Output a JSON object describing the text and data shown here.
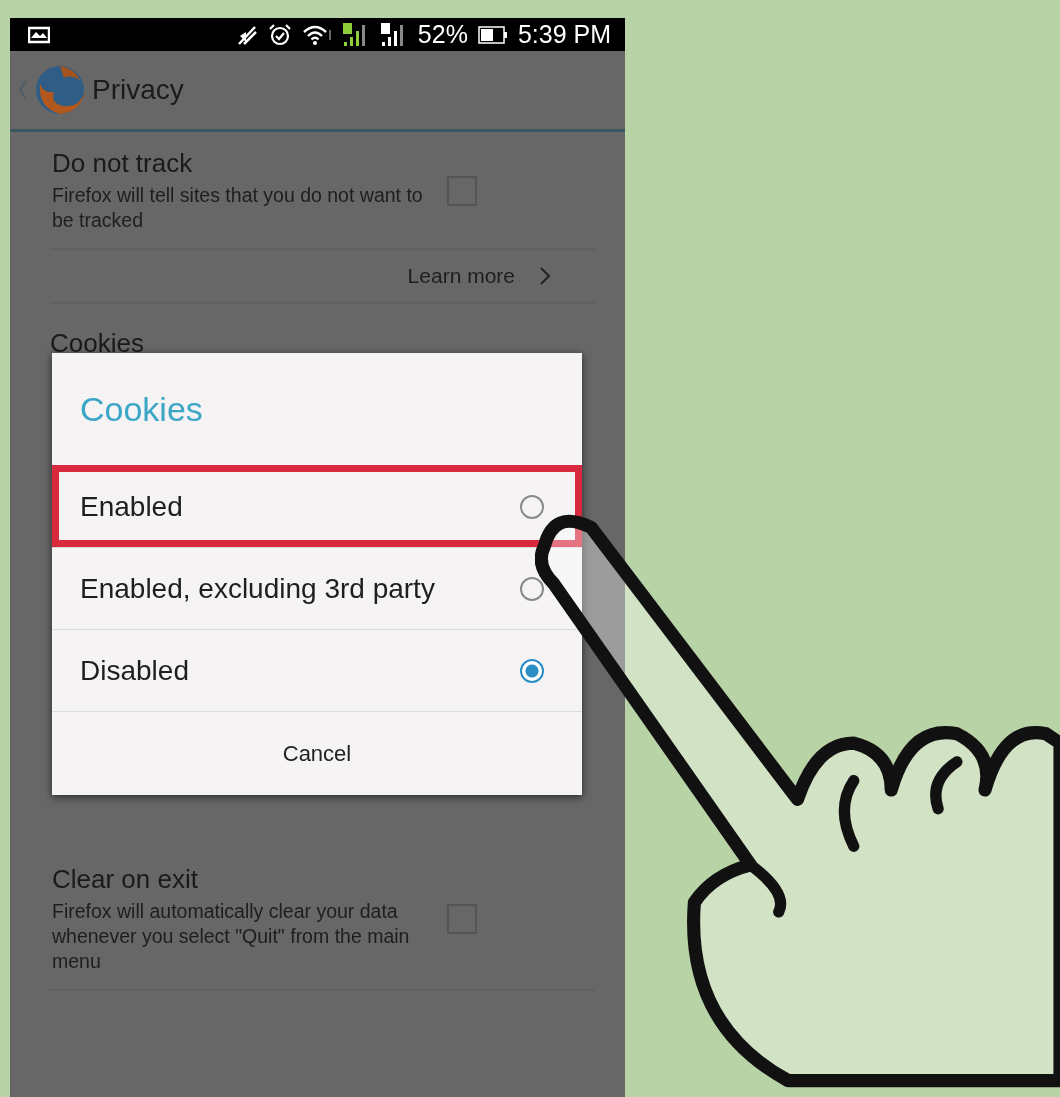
{
  "status_bar": {
    "battery": "52%",
    "time": "5:39 PM"
  },
  "toolbar": {
    "title": "Privacy"
  },
  "settings": [
    {
      "kind": "checkbox",
      "title": "Do not track",
      "summary": "Firefox will tell sites that you do not want to be tracked",
      "checked": false
    },
    {
      "kind": "link",
      "label": "Learn more"
    },
    {
      "kind": "header",
      "title": "Cookies"
    },
    {
      "kind": "checkbox",
      "title": "Clear on exit",
      "summary": "Firefox will automatically clear your data whenever you select \"Quit\" from the main menu",
      "checked": false
    }
  ],
  "dialog": {
    "title": "Cookies",
    "options": [
      {
        "label": "Enabled",
        "selected": false,
        "highlighted": true
      },
      {
        "label": "Enabled, excluding 3rd party",
        "selected": false,
        "highlighted": false
      },
      {
        "label": "Disabled",
        "selected": true,
        "highlighted": false
      }
    ],
    "button": "Cancel"
  }
}
